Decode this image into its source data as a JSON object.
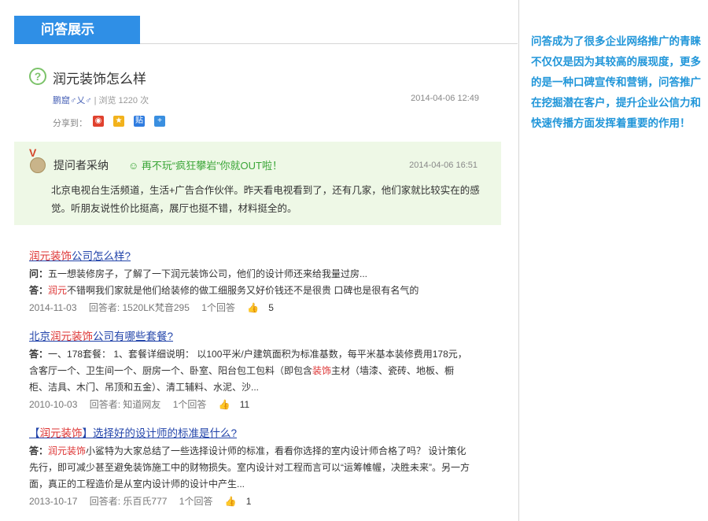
{
  "header": {
    "title": "问答展示"
  },
  "sidebar": {
    "text": "问答成为了很多企业网络推广的青睐不仅仅是因为其较高的展现度，更多的是一种口碑宣传和营销，问答推广在挖掘潜在客户，提升企业公信力和快速传播方面发挥着重要的作用！"
  },
  "question": {
    "title": "润元装饰怎么样",
    "asker": "鹏窟♂乂♂",
    "views": "浏览 1220 次",
    "time": "2014-04-06 12:49",
    "share_label": "分享到："
  },
  "adopted": {
    "title": "提问者采纳",
    "promo": "再不玩“疯狂攀岩”你就OUT啦！",
    "time": "2014-04-06 16:51",
    "body": "北京电视台生活频道，生活+广告合作伙伴。昨天看电视看到了，还有几家，他们家就比较实在的感觉。听朋友说性价比挺高，展厅也挺不错，材料挺全的。"
  },
  "results": [
    {
      "title_pre": "",
      "title_hl": "润元装饰",
      "title_post": "公司怎么样?",
      "q_label": "问：",
      "q_text": "五一想装修房子，了解了一下润元装饰公司，他们的设计师还来给我量过房...",
      "a_label": "答：",
      "a_hl": "润元",
      "a_text": "不错啊我们家就是他们给装修的做工细服务又好价钱还不是很贵 口碑也是很有名气的",
      "date": "2014-11-03",
      "answerer": "回答者: 1520LK梵音295",
      "answers": "1个回答",
      "likes": "5"
    },
    {
      "title_pre": "北京",
      "title_hl": "润元装饰",
      "title_post": "公司有哪些套餐?",
      "a_label": "答：",
      "a_text1": "一、178套餐： 1、套餐详细说明： 以100平米/户建筑面积为标准基数，每平米基本装修费用178元，含客厅一个、卫生间一个、厨房一个、卧室、阳台包工包料（即包含",
      "a_hl": "装饰",
      "a_text2": "主材（墙漆、瓷砖、地板、橱柜、洁具、木门、吊顶和五金）、清工辅料、水泥、沙...",
      "date": "2010-10-03",
      "answerer": "回答者: 知道网友",
      "answers": "1个回答",
      "likes": "11"
    },
    {
      "title_pre": "【",
      "title_hl": "润元装饰",
      "title_post": "】选择好的设计师的标准是什么?",
      "a_label": "答：",
      "a_hl": "润元装饰",
      "a_text": "小鲨特为大家总结了一些选择设计师的标准，看看你选择的室内设计师合格了吗？ 设计策化先行，即可减少甚至避免装饰施工中的财物损失。室内设计对工程而言可以“运筹帷幄，决胜未来”。另一方面，真正的工程造价是从室内设计师的设计中产生...",
      "date": "2013-10-17",
      "answerer": "回答者: 乐百氏777",
      "answers": "1个回答",
      "likes": "1"
    }
  ]
}
